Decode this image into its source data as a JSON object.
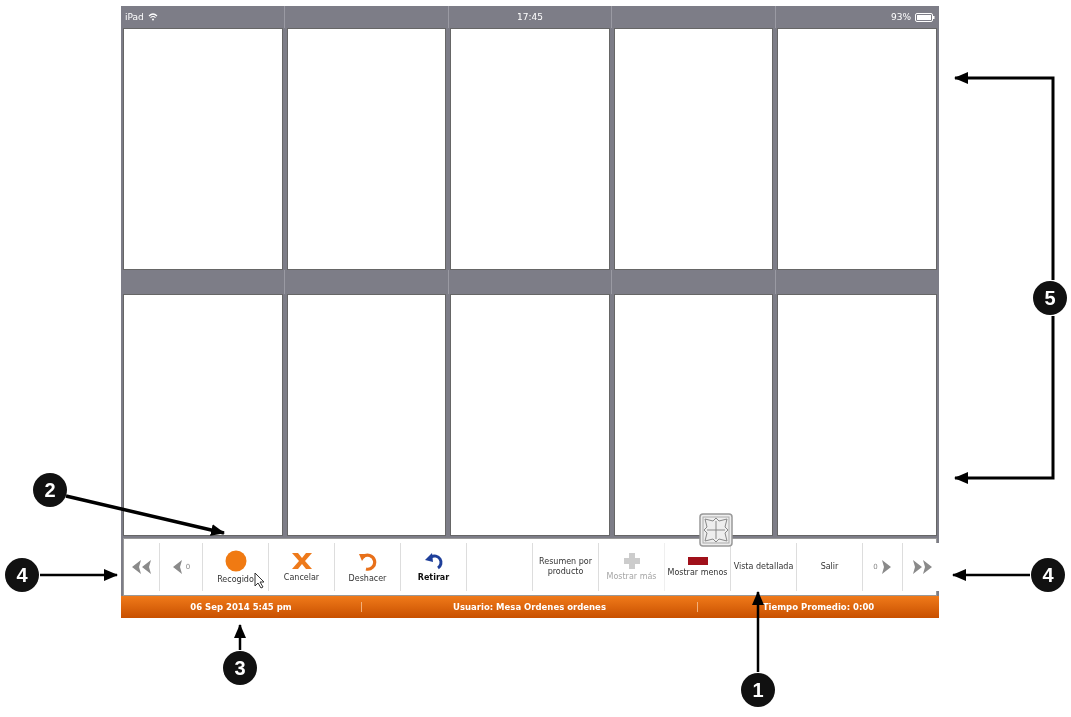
{
  "status_bar": {
    "device": "iPad",
    "time": "17:45",
    "battery": "93%"
  },
  "toolbar": [
    {
      "kind": "first",
      "disabled": false
    },
    {
      "kind": "prev",
      "count": "0",
      "disabled": false
    },
    {
      "kind": "pick",
      "label": "Recogido",
      "disabled": false,
      "bold": false
    },
    {
      "kind": "cancel",
      "label": "Cancelar",
      "disabled": false,
      "bold": false
    },
    {
      "kind": "undo",
      "label": "Deshacer",
      "disabled": false,
      "bold": false
    },
    {
      "kind": "retire",
      "label": "Retirar",
      "disabled": false,
      "bold": true
    },
    {
      "kind": "blank"
    },
    {
      "kind": "text",
      "label": "Resumen por producto",
      "disabled": false,
      "bold": false
    },
    {
      "kind": "plus",
      "label": "Mostrar más",
      "disabled": true,
      "bold": false
    },
    {
      "kind": "minus",
      "label": "Mostrar menos",
      "disabled": false,
      "bold": false
    },
    {
      "kind": "text",
      "label": "Vista detallada",
      "disabled": false,
      "bold": false
    },
    {
      "kind": "text",
      "label": "Salir",
      "disabled": false,
      "bold": false
    },
    {
      "kind": "next",
      "count": "0",
      "disabled": false
    },
    {
      "kind": "last",
      "disabled": false
    }
  ],
  "footer": {
    "date": "06 Sep 2014 5:45 pm",
    "user": "Usuario: Mesa Ordenes ordenes",
    "average": "Tiempo Promedio: 0:00"
  },
  "callouts": [
    {
      "number": "2"
    },
    {
      "number": "4"
    },
    {
      "number": "3"
    },
    {
      "number": "1"
    },
    {
      "number": "4"
    },
    {
      "number": "5"
    }
  ]
}
